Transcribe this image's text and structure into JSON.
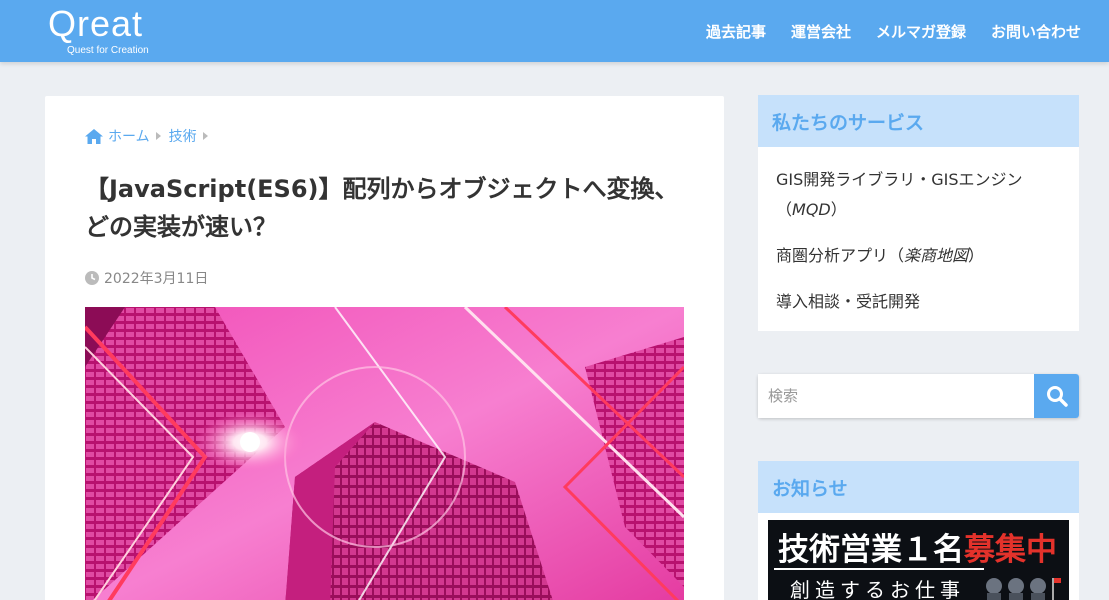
{
  "header": {
    "logo_text": "Qreat",
    "logo_tagline": "Quest for Creation",
    "nav": [
      {
        "label": "過去記事"
      },
      {
        "label": "運営会社"
      },
      {
        "label": "メルマガ登録"
      },
      {
        "label": "お問い合わせ"
      }
    ]
  },
  "breadcrumb": {
    "home": "ホーム",
    "category": "技術"
  },
  "article": {
    "title": "【JavaScript(ES6)】配列からオブジェクトへ変換、どの実装が速い？",
    "date": "2022年3月11日",
    "hero_icon": "city-buildings-neon-image"
  },
  "sidebar": {
    "services": {
      "heading": "私たちのサービス",
      "items": [
        {
          "prefix": "GIS開発ライブラリ・GISエンジン（",
          "emph": "MQD",
          "suffix": "）"
        },
        {
          "prefix": "商圏分析アプリ（",
          "emph": "楽商地図",
          "suffix": "）"
        },
        {
          "prefix": "導入相談・受託開発",
          "emph": "",
          "suffix": ""
        }
      ]
    },
    "search": {
      "placeholder": "検索"
    },
    "news": {
      "heading": "お知らせ",
      "banner_text_white": "技術営業１名",
      "banner_text_red": "募集中",
      "banner_sub": "創造するお仕事"
    }
  },
  "colors": {
    "accent": "#5aa9ef",
    "widget_head_bg": "#c6e1fb",
    "hero_pink": "#e83aa8",
    "banner_red": "#e4322b"
  }
}
